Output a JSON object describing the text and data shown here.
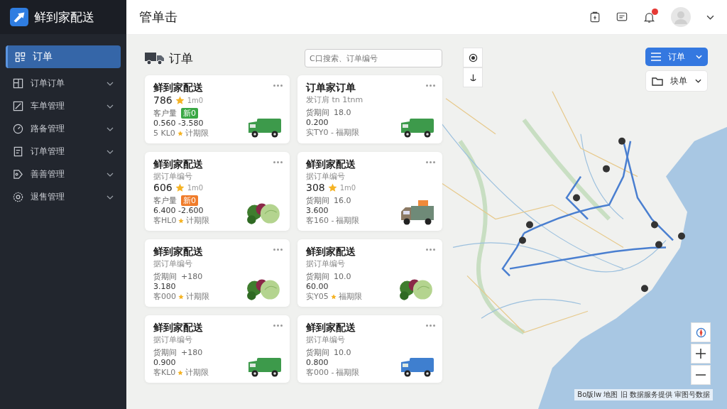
{
  "sidebar": {
    "logo": "鲜到家配送",
    "items": [
      {
        "label": "订单",
        "selected": true,
        "expandable": false
      },
      {
        "label": "订单订单",
        "selected": false,
        "expandable": true
      },
      {
        "label": "车单管理",
        "selected": false,
        "expandable": true
      },
      {
        "label": "路备管理",
        "selected": false,
        "expandable": true
      },
      {
        "label": "订单管理",
        "selected": false,
        "expandable": true
      },
      {
        "label": "善善管理",
        "selected": false,
        "expandable": true
      },
      {
        "label": "退售管理",
        "selected": false,
        "expandable": true
      }
    ]
  },
  "header": {
    "title": "管单击",
    "notification_badge": true
  },
  "orders": {
    "title": "订单",
    "search": {
      "placeholder": "C口搜索、订单编号"
    },
    "cards": [
      {
        "title": "鲜到家配送",
        "rating": {
          "value": "786",
          "unit": "1m0"
        },
        "label": "客户量",
        "tag": {
          "text": "新0",
          "color": "#3aa845"
        },
        "amount": "0.560 -3.580",
        "footer": "5 KL0",
        "footer_star": true,
        "footer_note": "计期限",
        "image": {
          "kind": "van",
          "color": "#3d9a4b"
        }
      },
      {
        "title": "订单家订单",
        "subtitle": "发订肩 tn 1tnm",
        "label": "货期间",
        "value": "18.0",
        "amount": "0.200",
        "footer": "实TY0 -",
        "footer_star": false,
        "footer_note": "福期限",
        "image": {
          "kind": "van",
          "color": "#3d9a4b"
        }
      },
      {
        "title": "鲜到家配送",
        "subtitle": "据订单编号",
        "rating": {
          "value": "606",
          "unit": "1m0"
        },
        "label": "客户量",
        "tag": {
          "text": "新0",
          "color": "#f07c2a"
        },
        "amount": "6.400 -2.600",
        "footer": "客HL0",
        "footer_star": true,
        "footer_note": "计期限",
        "image": {
          "kind": "vegetables"
        }
      },
      {
        "title": "鲜到家配送",
        "subtitle": "据订单编号",
        "rating": {
          "value": "308",
          "unit": "1m0"
        },
        "label": "货期间",
        "value": "16.0",
        "amount": "3.600",
        "footer": "客160 -",
        "footer_star": false,
        "footer_note": "福期限",
        "image": {
          "kind": "truck"
        }
      },
      {
        "title": "鲜到家配送",
        "subtitle": "据订单编号",
        "label": "货期间",
        "value": "+180",
        "amount": "3.180",
        "footer": "客000",
        "footer_star": true,
        "footer_note": "计期限",
        "image": {
          "kind": "vegetables"
        }
      },
      {
        "title": "鲜到家配送",
        "subtitle": "据订单编号",
        "label": "货期间",
        "value": "10.0",
        "amount": "60.00",
        "footer": "实Y05",
        "footer_star": true,
        "footer_note": "福期限",
        "image": {
          "kind": "vegetables"
        }
      },
      {
        "title": "鲜到家配送",
        "subtitle": "据订单编号",
        "label": "货期间",
        "value": "+180",
        "amount": "0.900",
        "footer": "客KL0",
        "footer_star": true,
        "footer_note": "计期限",
        "image": {
          "kind": "van",
          "color": "#3d9a4b"
        }
      },
      {
        "title": "鲜到家配送",
        "subtitle": "据订单编号",
        "label": "货期间",
        "value": "10.0",
        "amount": "0.800",
        "footer": "客000 -",
        "footer_star": false,
        "footer_note": "福期限",
        "image": {
          "kind": "van",
          "color": "#3f7fcf"
        }
      }
    ]
  },
  "map": {
    "view_dropdown": "订单",
    "filter_dropdown": "块单",
    "attribution": "Bo版lw  地图 旧 数据服务提供 审图号数据"
  }
}
